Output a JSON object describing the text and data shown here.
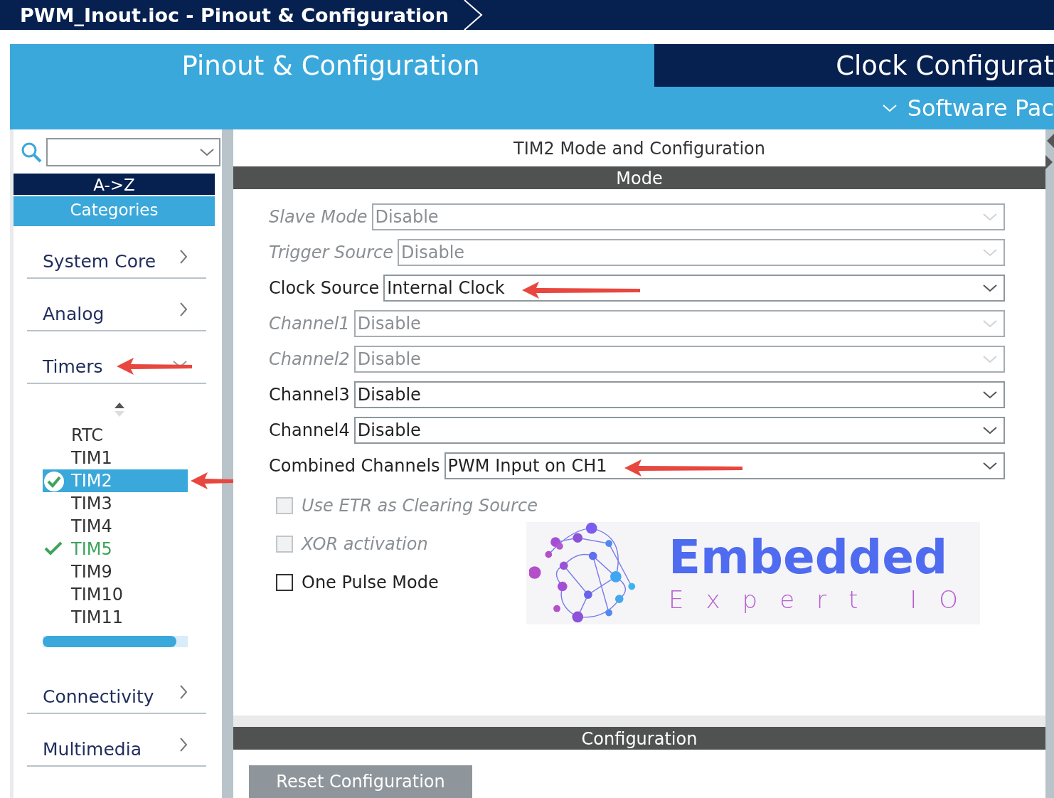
{
  "window": {
    "title": "PWM_Inout.ioc - Pinout & Configuration"
  },
  "tabs": [
    {
      "label": "Pinout & Configuration",
      "selected": true
    },
    {
      "label": "Clock Configurat",
      "selected": false
    }
  ],
  "software_packs": {
    "label": "Software Pac"
  },
  "sidebar": {
    "sort_button": "A->Z",
    "categories_button": "Categories",
    "categories": [
      {
        "name": "System Core",
        "expanded": false,
        "annotated": false
      },
      {
        "name": "Analog",
        "expanded": false,
        "annotated": false
      },
      {
        "name": "Timers",
        "expanded": true,
        "annotated": true,
        "children": [
          {
            "name": "RTC",
            "selected": false,
            "checked": false,
            "annotated": false
          },
          {
            "name": "TIM1",
            "selected": false,
            "checked": false,
            "annotated": false
          },
          {
            "name": "TIM2",
            "selected": true,
            "checked": true,
            "annotated": true
          },
          {
            "name": "TIM3",
            "selected": false,
            "checked": false,
            "annotated": false
          },
          {
            "name": "TIM4",
            "selected": false,
            "checked": false,
            "annotated": false
          },
          {
            "name": "TIM5",
            "selected": false,
            "checked": true,
            "annotated": false
          },
          {
            "name": "TIM9",
            "selected": false,
            "checked": false,
            "annotated": false
          },
          {
            "name": "TIM10",
            "selected": false,
            "checked": false,
            "annotated": false
          },
          {
            "name": "TIM11",
            "selected": false,
            "checked": false,
            "annotated": false
          }
        ]
      },
      {
        "name": "Connectivity",
        "expanded": false,
        "annotated": false
      },
      {
        "name": "Multimedia",
        "expanded": false,
        "annotated": false
      }
    ]
  },
  "panel": {
    "title": "TIM2 Mode and Configuration",
    "mode_header": "Mode",
    "fields": [
      {
        "kind": "select",
        "label": "Slave Mode",
        "value": "Disable",
        "disabled": true,
        "annotated": false
      },
      {
        "kind": "select",
        "label": "Trigger Source",
        "value": "Disable",
        "disabled": true,
        "annotated": false
      },
      {
        "kind": "select",
        "label": "Clock Source",
        "value": "Internal Clock",
        "disabled": false,
        "annotated": true
      },
      {
        "kind": "select",
        "label": "Channel1",
        "value": "Disable",
        "disabled": true,
        "annotated": false
      },
      {
        "kind": "select",
        "label": "Channel2",
        "value": "Disable",
        "disabled": true,
        "annotated": false
      },
      {
        "kind": "select",
        "label": "Channel3",
        "value": "Disable",
        "disabled": false,
        "annotated": false
      },
      {
        "kind": "select",
        "label": "Channel4",
        "value": "Disable",
        "disabled": false,
        "annotated": false
      },
      {
        "kind": "select",
        "label": "Combined Channels",
        "value": "PWM Input on CH1",
        "disabled": false,
        "annotated": true
      },
      {
        "kind": "checkbox",
        "label": "Use ETR as Clearing Source",
        "checked": false,
        "disabled": true
      },
      {
        "kind": "checkbox",
        "label": "XOR activation",
        "checked": false,
        "disabled": true
      },
      {
        "kind": "checkbox",
        "label": "One Pulse Mode",
        "checked": false,
        "disabled": false
      }
    ],
    "logo": {
      "title": "Embedded",
      "subtitle": "Expert IO"
    },
    "config_header": "Configuration",
    "reset_button": "Reset Configuration"
  }
}
